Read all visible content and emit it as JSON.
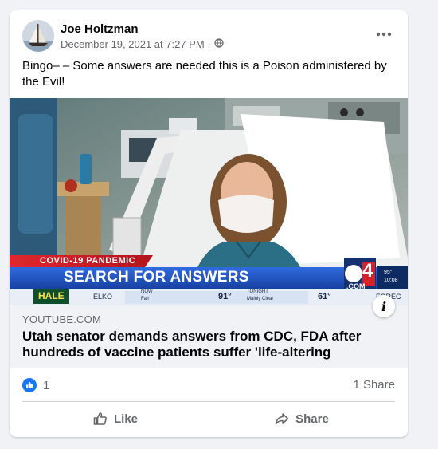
{
  "post": {
    "author": "Joe Holtzman",
    "timestamp": "December 19, 2021 at 7:27 PM",
    "separator": "·",
    "privacy_icon": "globe-icon",
    "text": "Bingo– – Some answers are needed this is a Poison administered by the Evil!"
  },
  "video": {
    "banner_kicker": "COVID-19 PANDEMIC",
    "banner_headline": "SEARCH FOR ANSWERS",
    "station": "4",
    "station_com": ".COM",
    "temp_corner": "95°",
    "time_corner": "10:08",
    "ticker_sponsor": "HALE",
    "ticker_city": "ELKO",
    "ticker_now_label": "NOW",
    "ticker_now_sub": "Fair",
    "ticker_now_temp": "91°",
    "ticker_tonight_label": "TONIGHT",
    "ticker_tonight_sub": "Mainly Clear",
    "ticker_tonight_temp": "61°",
    "ticker_forecast": "FOREC"
  },
  "link": {
    "domain": "YOUTUBE.COM",
    "title": "Utah senator demands answers from CDC, FDA after hundreds of vaccine patients suffer 'life-altering"
  },
  "stats": {
    "reaction_count": "1",
    "shares": "1 Share"
  },
  "actions": {
    "like": "Like",
    "share": "Share"
  },
  "colors": {
    "accent": "#1877f2",
    "banner_red": "#d6202a",
    "banner_blue": "#1f4fc4"
  }
}
